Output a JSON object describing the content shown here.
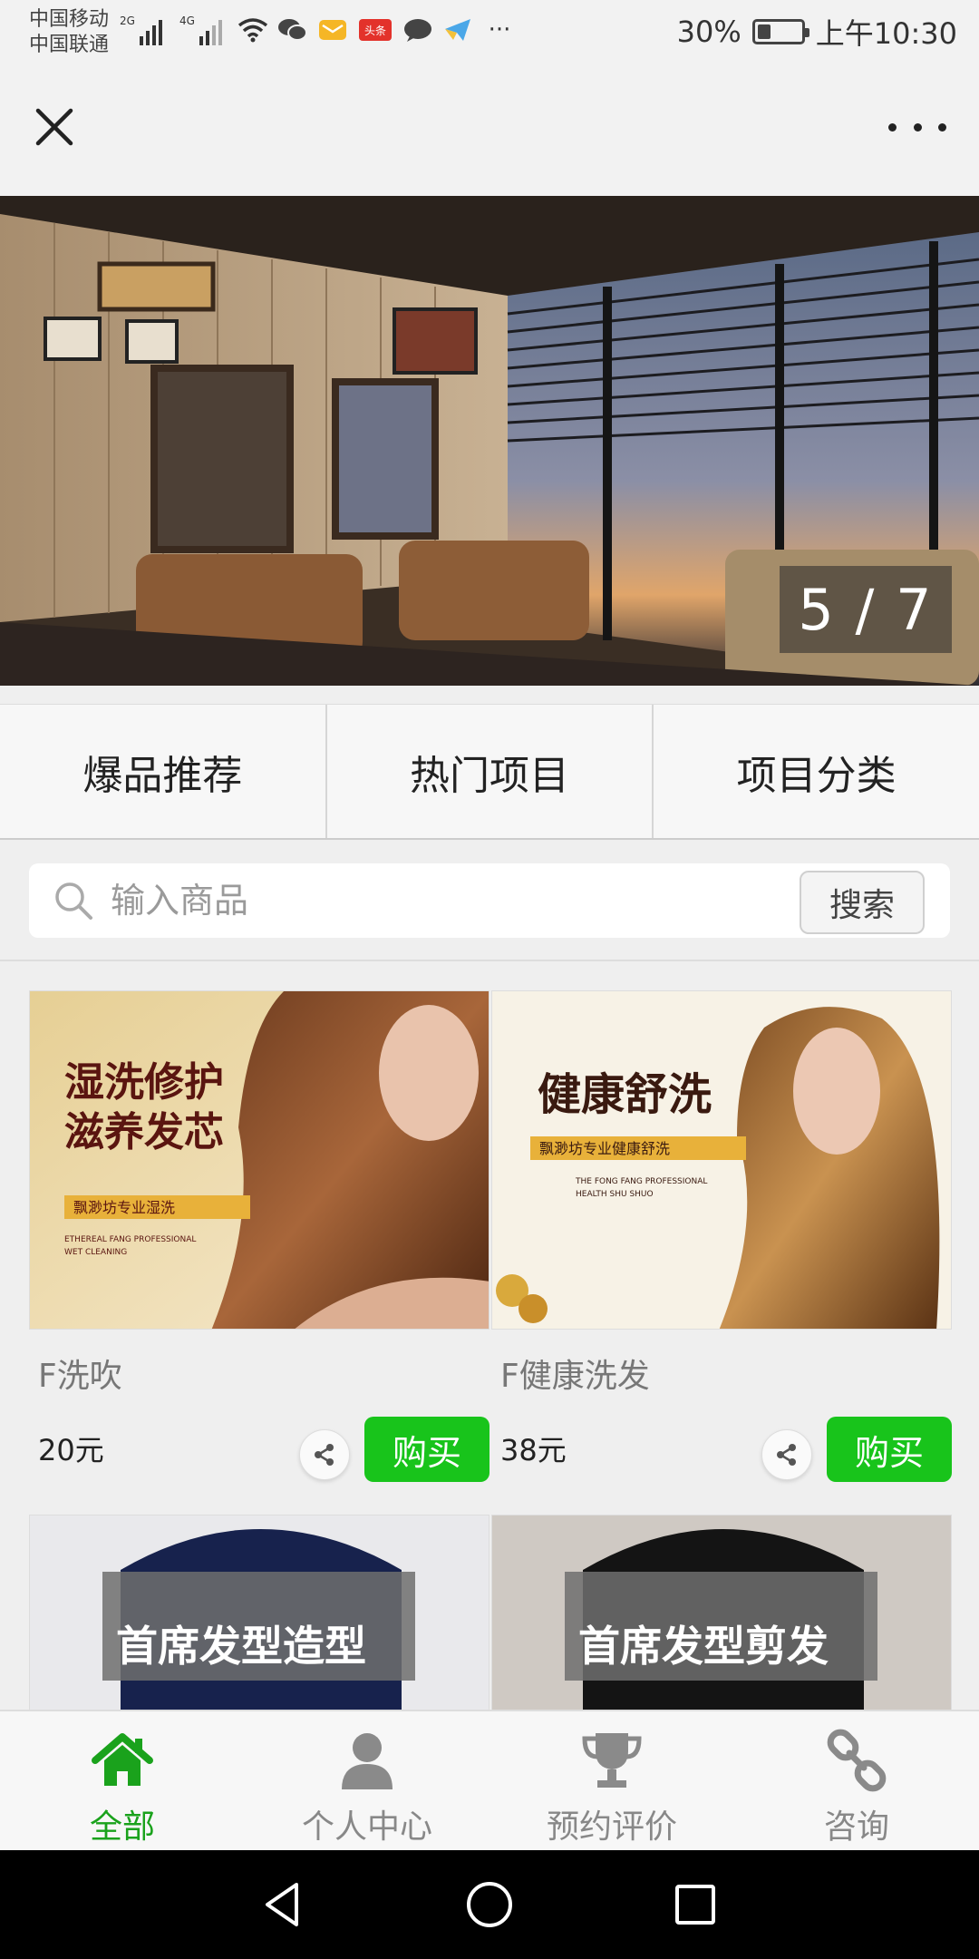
{
  "status_bar": {
    "carrier_1": "中国移动",
    "carrier_2": "中国联通",
    "net_1": "2G",
    "net_2": "4G",
    "toutiao_badge": "头条",
    "more_dots": "···",
    "battery": "30%",
    "battery_level": 0.3,
    "time": "上午10:30"
  },
  "banner": {
    "counter": "5 / 7",
    "current": 5,
    "total": 7
  },
  "tabs": [
    {
      "label": "爆品推荐"
    },
    {
      "label": "热门项目"
    },
    {
      "label": "项目分类"
    }
  ],
  "search": {
    "placeholder": "输入商品",
    "button": "搜索"
  },
  "products": [
    {
      "name": "F洗吹",
      "price": "20元",
      "buy": "购买",
      "image": {
        "title_1": "湿洗修护",
        "title_2": "滋养发芯",
        "tag": "飘渺坊专业湿洗",
        "en_1": "ETHEREAL FANG PROFESSIONAL",
        "en_2": "WET CLEANING"
      }
    },
    {
      "name": "F健康洗发",
      "price": "38元",
      "buy": "购买",
      "image": {
        "title_1": "健康舒洗",
        "tag": "飘渺坊专业健康舒洗",
        "en_1": "THE FONG FANG PROFESSIONAL",
        "en_2": "HEALTH SHU SHUO"
      }
    },
    {
      "image": {
        "title_1": "首席发型造型"
      }
    },
    {
      "image": {
        "title_1": "首席发型剪发"
      }
    }
  ],
  "bottom_nav": [
    {
      "label": "全部",
      "icon": "home-icon",
      "active": true
    },
    {
      "label": "个人中心",
      "icon": "user-icon",
      "active": false
    },
    {
      "label": "预约评价",
      "icon": "trophy-icon",
      "active": false
    },
    {
      "label": "咨询",
      "icon": "link-icon",
      "active": false
    }
  ],
  "colors": {
    "accent_green": "#18c41b",
    "active_nav": "#1aa21c"
  }
}
